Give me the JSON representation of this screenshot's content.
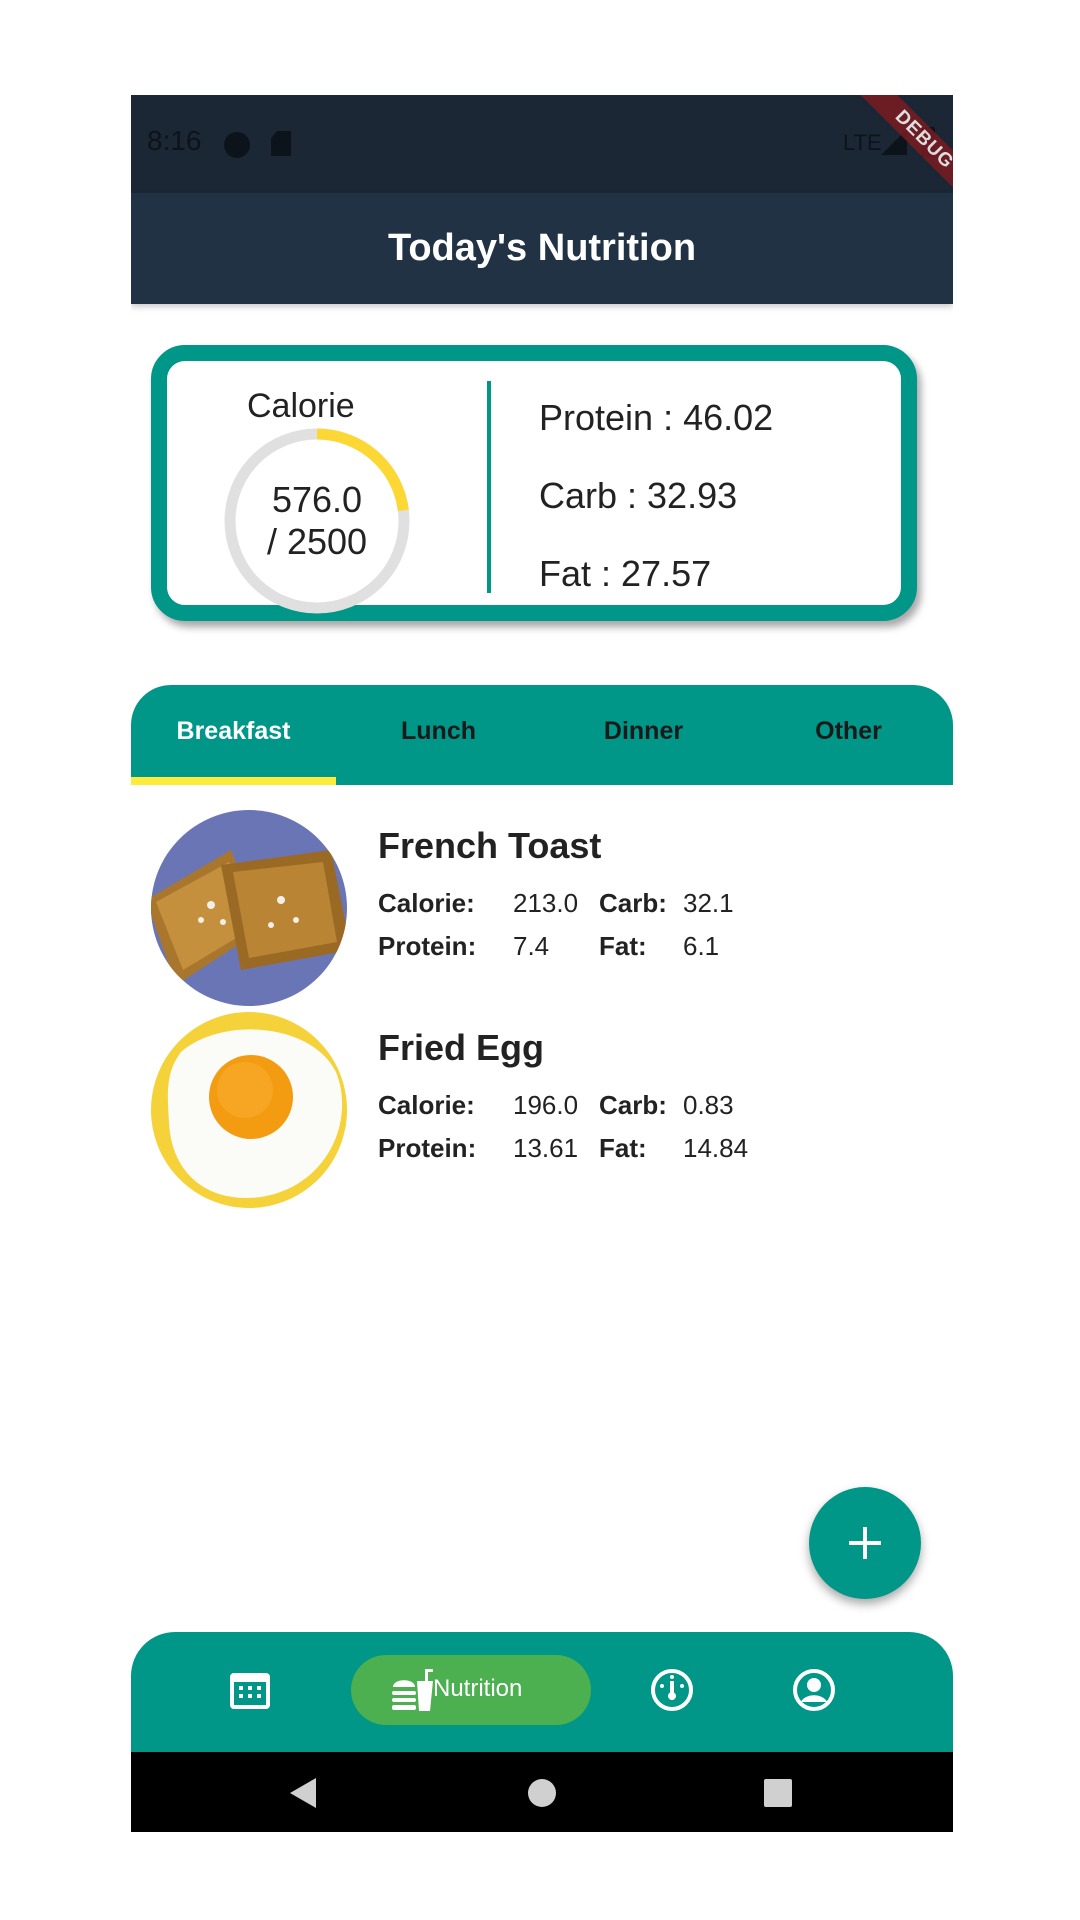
{
  "status_bar": {
    "time": "8:16",
    "network": "LTE",
    "debug_banner": "DEBUG"
  },
  "app_bar": {
    "title": "Today's Nutrition"
  },
  "summary": {
    "calorie_label": "Calorie",
    "calorie_consumed": "576.0",
    "calorie_goal_text": "/ 2500",
    "calorie_progress": 0.2304,
    "protein": "Protein : 46.02",
    "carb": "Carb : 32.93",
    "fat": "Fat : 27.57"
  },
  "tabs": [
    {
      "label": "Breakfast",
      "active": true
    },
    {
      "label": "Lunch",
      "active": false
    },
    {
      "label": "Dinner",
      "active": false
    },
    {
      "label": "Other",
      "active": false
    }
  ],
  "labels": {
    "calorie": "Calorie:",
    "protein": "Protein:",
    "carb": "Carb:",
    "fat": "Fat:"
  },
  "foods": [
    {
      "name": "French Toast",
      "calorie": "213.0",
      "protein": "7.4",
      "carb": "32.1",
      "fat": "6.1"
    },
    {
      "name": "Fried Egg",
      "calorie": "196.0",
      "protein": "13.61",
      "carb": "0.83",
      "fat": "14.84"
    }
  ],
  "fab": {
    "icon": "plus-icon"
  },
  "bottom_nav": {
    "items": [
      {
        "icon": "calendar-icon"
      },
      {
        "icon": "food-icon",
        "label": "Nutrition",
        "active": true
      },
      {
        "icon": "gauge-icon"
      },
      {
        "icon": "account-icon"
      }
    ]
  },
  "colors": {
    "primary": "#009688",
    "app_bar": "#203244",
    "accent": "#ffeb3b",
    "nav_active": "#4caf50",
    "ring": "#fdd835"
  }
}
